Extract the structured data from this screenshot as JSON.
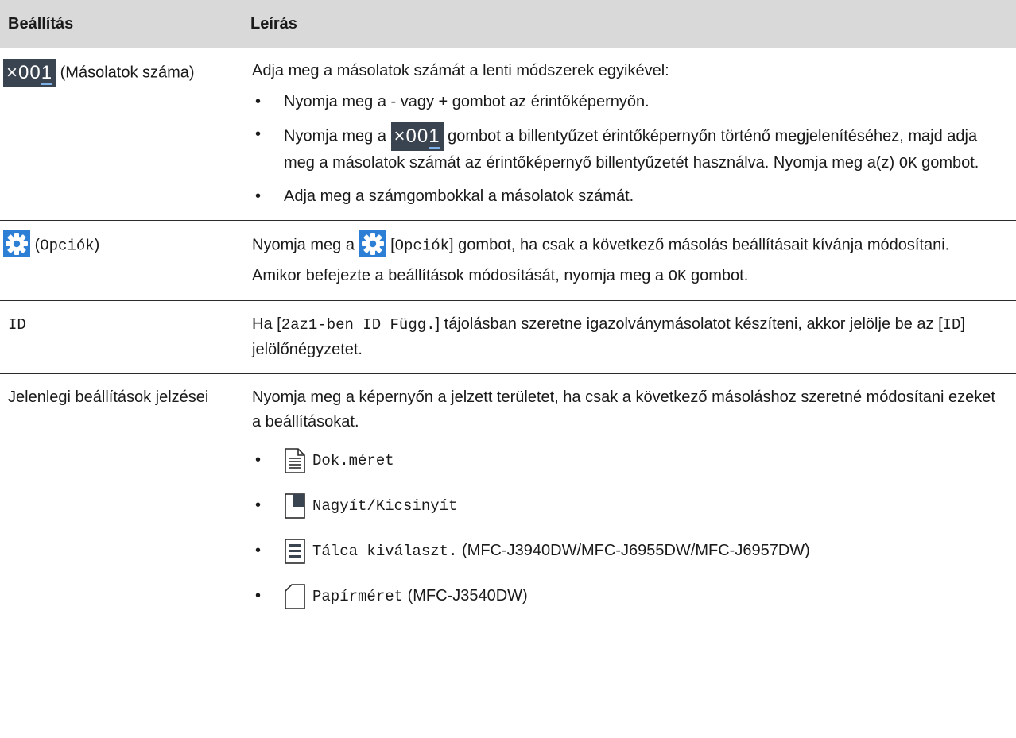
{
  "header": {
    "col1": "Beállítás",
    "col2": "Leírás"
  },
  "rows": {
    "copies": {
      "badge_prefix": "×00",
      "badge_digit": "1",
      "setting_label": "(Másolatok száma)",
      "intro": "Adja meg a másolatok számát a lenti módszerek egyikével:",
      "b1": "Nyomja meg a - vagy + gombot az érintőképernyőn.",
      "b2_pre": "Nyomja meg a",
      "b2_post": "gombot a billentyűzet érintőképernyőn történő megjelenítéséhez, majd adja meg a másolatok számát az érintőképernyő billentyűzetét használva. Nyomja meg a(z)",
      "b2_ok": "OK",
      "b2_end": "gombot.",
      "b3": "Adja meg a számgombokkal a másolatok számát."
    },
    "options": {
      "open": "(",
      "label": "Opciók",
      "close": ")",
      "p1_pre": "Nyomja meg a",
      "p1_bracket_open": "[",
      "p1_label": "Opciók",
      "p1_bracket_close": "]",
      "p1_post": "gombot, ha csak a következő másolás beállításait kívánja módosítani.",
      "p2_pre": "Amikor befejezte a beállítások módosítását, nyomja meg a",
      "p2_ok": "OK",
      "p2_end": "gombot."
    },
    "id": {
      "label": "ID",
      "p_pre": "Ha [",
      "p_mono1": "2az1-ben ID Függ.",
      "p_mid": "] tájolásban szeretne igazolványmásolatot készíteni, akkor jelölje be az [",
      "p_mono2": "ID",
      "p_end": "] jelölőnégyzetet."
    },
    "indicators": {
      "label": "Jelenlegi beállítások jelzései",
      "intro": "Nyomja meg a képernyőn a jelzett területet, ha csak a következő másoláshoz szeretné módosítani ezeket a beállításokat.",
      "items": [
        {
          "icon": "document-size-icon",
          "text": "Dok.méret",
          "note": ""
        },
        {
          "icon": "enlarge-reduce-icon",
          "text": "Nagyít/Kicsinyít",
          "note": ""
        },
        {
          "icon": "tray-select-icon",
          "text": "Tálca kiválaszt.",
          "note": "(MFC-J3940DW/MFC-J6955DW/MFC-J6957DW)"
        },
        {
          "icon": "paper-size-icon",
          "text": "Papírméret",
          "note": "(MFC-J3540DW)"
        }
      ]
    }
  },
  "colors": {
    "header_bg": "#d9d9d9",
    "badge_bg": "#3a4350",
    "gear_bg": "#2d7fd6"
  }
}
